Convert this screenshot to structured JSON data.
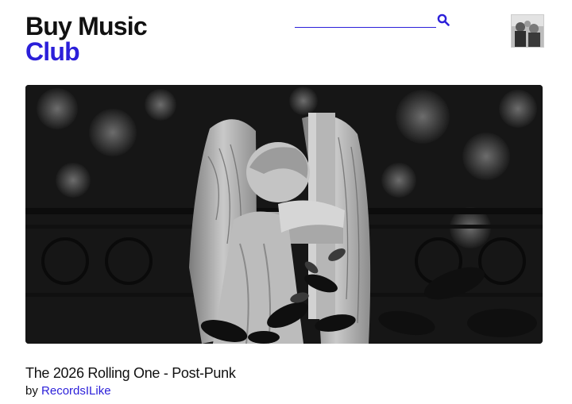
{
  "header": {
    "logo_line_1": "Buy Music",
    "logo_line_2": "Club"
  },
  "search": {
    "value": "",
    "placeholder": "",
    "icon": "search-icon"
  },
  "user": {
    "avatar_icon": "user-avatar-photo"
  },
  "featured": {
    "image_description_icon": "angel-statue-photo",
    "title": "The 2026 Rolling One - Post-Punk",
    "by_label": "by",
    "author": "RecordsILike"
  },
  "colors": {
    "accent": "#2b1fd9",
    "text": "#111111",
    "background": "#ffffff"
  }
}
